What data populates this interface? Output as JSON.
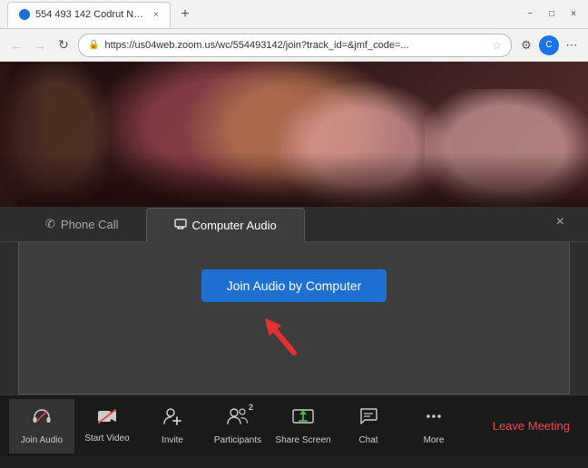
{
  "browser": {
    "tab_title": "554 493 142 Codrut Neagu's Zo...",
    "tab_close": "×",
    "new_tab": "+",
    "nav": {
      "back": "←",
      "forward": "→",
      "refresh": "↻"
    },
    "address": "https://us04web.zoom.us/wc/554493142/join?track_id=&jmf_code=...",
    "star": "☆",
    "window_controls": {
      "minimize": "−",
      "maximize": "□",
      "close": "×"
    }
  },
  "zoom": {
    "tabs": [
      {
        "id": "phone",
        "label": "Phone Call",
        "icon": "✆",
        "active": false
      },
      {
        "id": "computer",
        "label": "Computer Audio",
        "icon": "🖥",
        "active": true
      }
    ],
    "close_label": "×",
    "join_button_label": "Join Audio by Computer"
  },
  "toolbar": {
    "items": [
      {
        "id": "join-audio",
        "label": "Join Audio",
        "icon": "🎧",
        "active": true
      },
      {
        "id": "start-video",
        "label": "Start Video",
        "icon": "📷"
      },
      {
        "id": "invite",
        "label": "Invite",
        "icon": "👤"
      },
      {
        "id": "participants",
        "label": "Participants",
        "icon": "👥",
        "badge": "2"
      },
      {
        "id": "share-screen",
        "label": "Share Screen",
        "icon": "📤"
      },
      {
        "id": "chat",
        "label": "Chat",
        "icon": "💬"
      },
      {
        "id": "more",
        "label": "More",
        "icon": "•••"
      }
    ],
    "leave_label": "Leave Meeting"
  }
}
